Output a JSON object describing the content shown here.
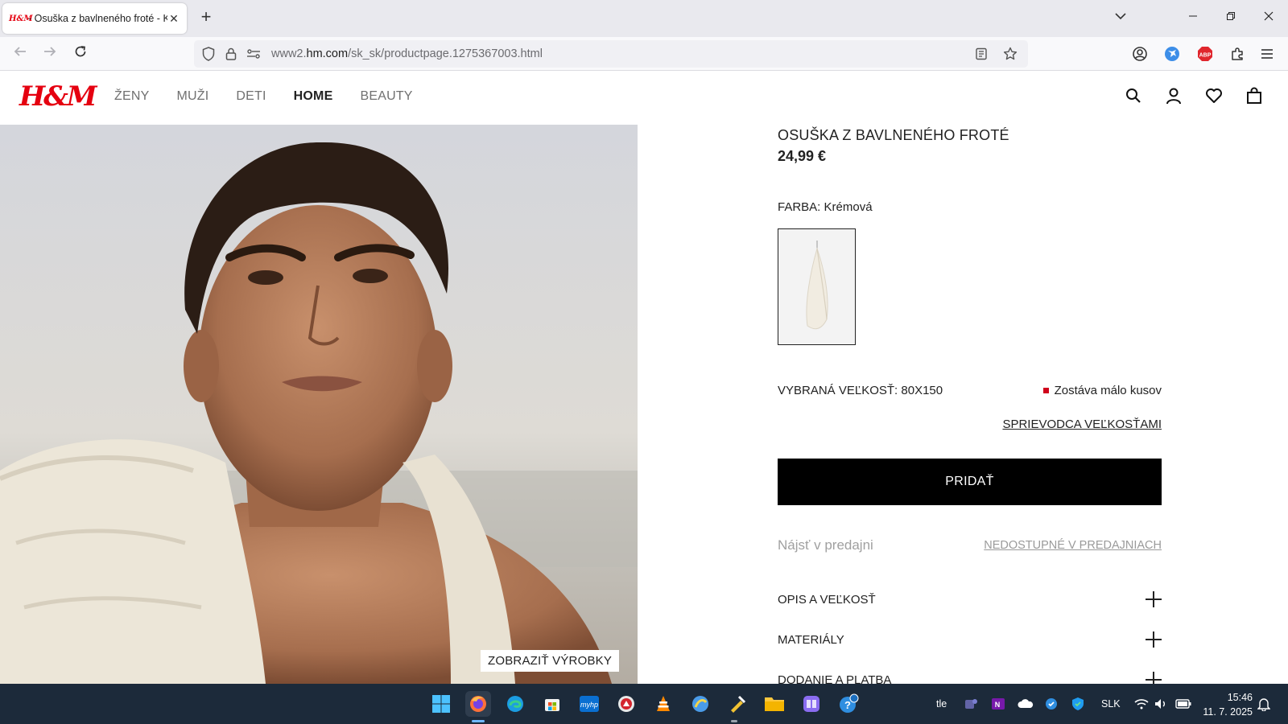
{
  "browser": {
    "tab": {
      "favicon_text": "H&M",
      "title": "- Osuška z bavlneného froté - K",
      "close_symbol": "✕"
    },
    "new_tab_symbol": "+",
    "url": {
      "prefix": "www2.",
      "domain": "hm.com",
      "path": "/sk_sk/productpage.1275367003.html"
    }
  },
  "site": {
    "logo": "H&M",
    "nav": [
      "ŽENY",
      "MUŽI",
      "DETI",
      "HOME",
      "BEAUTY"
    ],
    "nav_current": "HOME"
  },
  "hero": {
    "show_products_label": "ZOBRAZIŤ VÝROBKY"
  },
  "product": {
    "title": "OSUŠKA Z BAVLNENÉHO FROTÉ",
    "price": "24,99 €",
    "color_label": "FARBA: Krémová",
    "selected_size": "VYBRANÁ VEĽKOSŤ: 80X150",
    "stock_status": "Zostáva málo kusov",
    "size_guide": "SPRIEVODCA VEĽKOSŤAMI",
    "add_button": "PRIDAŤ",
    "find_in_store": "Nájsť v predajni",
    "store_unavailable": "NEDOSTUPNÉ V PREDAJNIACH",
    "accordion": [
      "OPIS A VEĽKOSŤ",
      "MATERIÁLY",
      "DODANIE A PLATBA"
    ]
  },
  "taskbar": {
    "language": "SLK",
    "weather_text": "tle",
    "time": "15:46",
    "date": "11. 7. 2025"
  },
  "colors": {
    "brand_red": "#e50010",
    "stock_red": "#d0021b",
    "taskbar_bg": "#1c2a3a"
  }
}
